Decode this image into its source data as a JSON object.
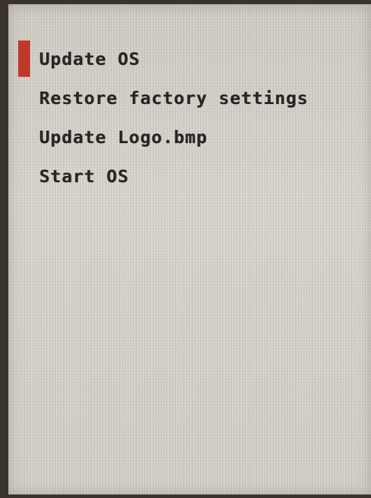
{
  "colors": {
    "accent": "#c0382a",
    "text": "#2a2424",
    "screen_background": "#d4d0c8",
    "bezel": "#3a322c"
  },
  "boot_menu": {
    "selected_index": 0,
    "items": [
      {
        "label": "Update OS"
      },
      {
        "label": "Restore factory settings"
      },
      {
        "label": "Update Logo.bmp"
      },
      {
        "label": "Start OS"
      }
    ]
  }
}
